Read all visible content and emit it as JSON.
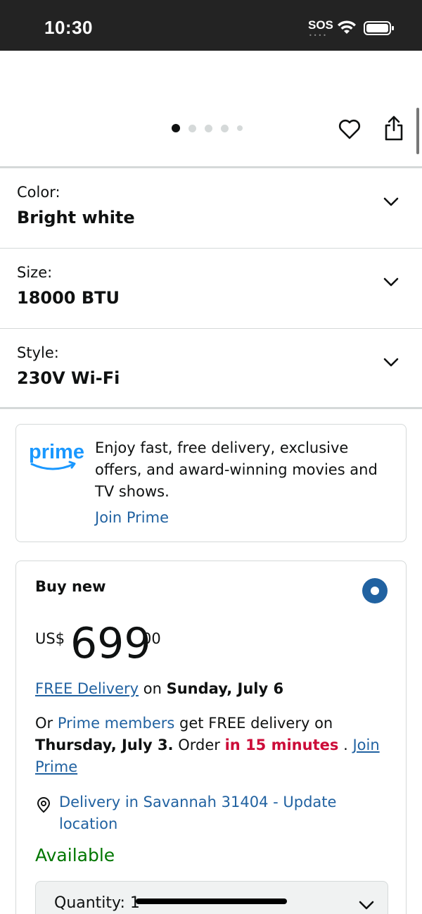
{
  "status_bar": {
    "time": "10:30",
    "sos": "SOS"
  },
  "image_area": {
    "carousel_dots": 5,
    "active_dot": 0,
    "icons": [
      "heart-icon",
      "share-icon"
    ]
  },
  "variations": [
    {
      "label": "Color:",
      "value": "Bright white"
    },
    {
      "label": "Size:",
      "value": "18000 BTU"
    },
    {
      "label": "Style:",
      "value": "230V Wi-Fi"
    }
  ],
  "prime_promo": {
    "logo_text": "prime",
    "text": "Enjoy fast, free delivery, exclusive offers, and award-winning movies and TV shows.",
    "link": "Join Prime"
  },
  "buy_box": {
    "title": "Buy new",
    "currency": "US$",
    "price_whole": "699",
    "price_fraction": "00",
    "free_delivery_link": "FREE Delivery",
    "free_delivery_on": "on",
    "free_delivery_date": "Sunday, July 6",
    "prime_prefix": "Or",
    "prime_members_link": "Prime members",
    "prime_suffix": "get FREE delivery on",
    "prime_date": "Thursday, July 3.",
    "order_text": "Order",
    "order_urgency": "in 15 minutes",
    "join_separator": ".",
    "join_prime_link": "Join Prime",
    "delivery_location": "Delivery in Savannah 31404 - Update location",
    "availability": "Available",
    "quantity_label": "Quantity:",
    "quantity_value": "1"
  },
  "colors": {
    "link": "#2162a1",
    "available": "#007600",
    "urgent": "#cc0c39",
    "status_bar_bg": "#232323",
    "prime_blue": "#1a98ff"
  }
}
